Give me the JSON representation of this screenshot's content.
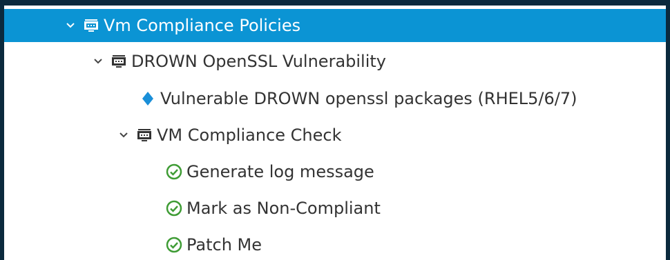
{
  "tree": {
    "items": [
      {
        "label": "Vm Compliance Policies",
        "icon": "policy-profile-icon",
        "state": "expanded",
        "selected": true
      },
      {
        "label": "DROWN OpenSSL Vulnerability",
        "icon": "policy-profile-icon",
        "state": "expanded"
      },
      {
        "label": "Vulnerable DROWN openssl packages (RHEL5/6/7)",
        "icon": "condition-diamond-icon"
      },
      {
        "label": "VM Compliance Check",
        "icon": "policy-profile-icon",
        "state": "expanded"
      },
      {
        "label": "Generate log message",
        "icon": "check-circle-icon"
      },
      {
        "label": "Mark as Non-Compliant",
        "icon": "check-circle-icon"
      },
      {
        "label": "Patch Me",
        "icon": "check-circle-icon"
      }
    ]
  },
  "colors": {
    "selected_bg": "#0b94d4",
    "frame_bg": "#0b2a3d",
    "diamond": "#1a8fd8",
    "check": "#3f9c35"
  }
}
